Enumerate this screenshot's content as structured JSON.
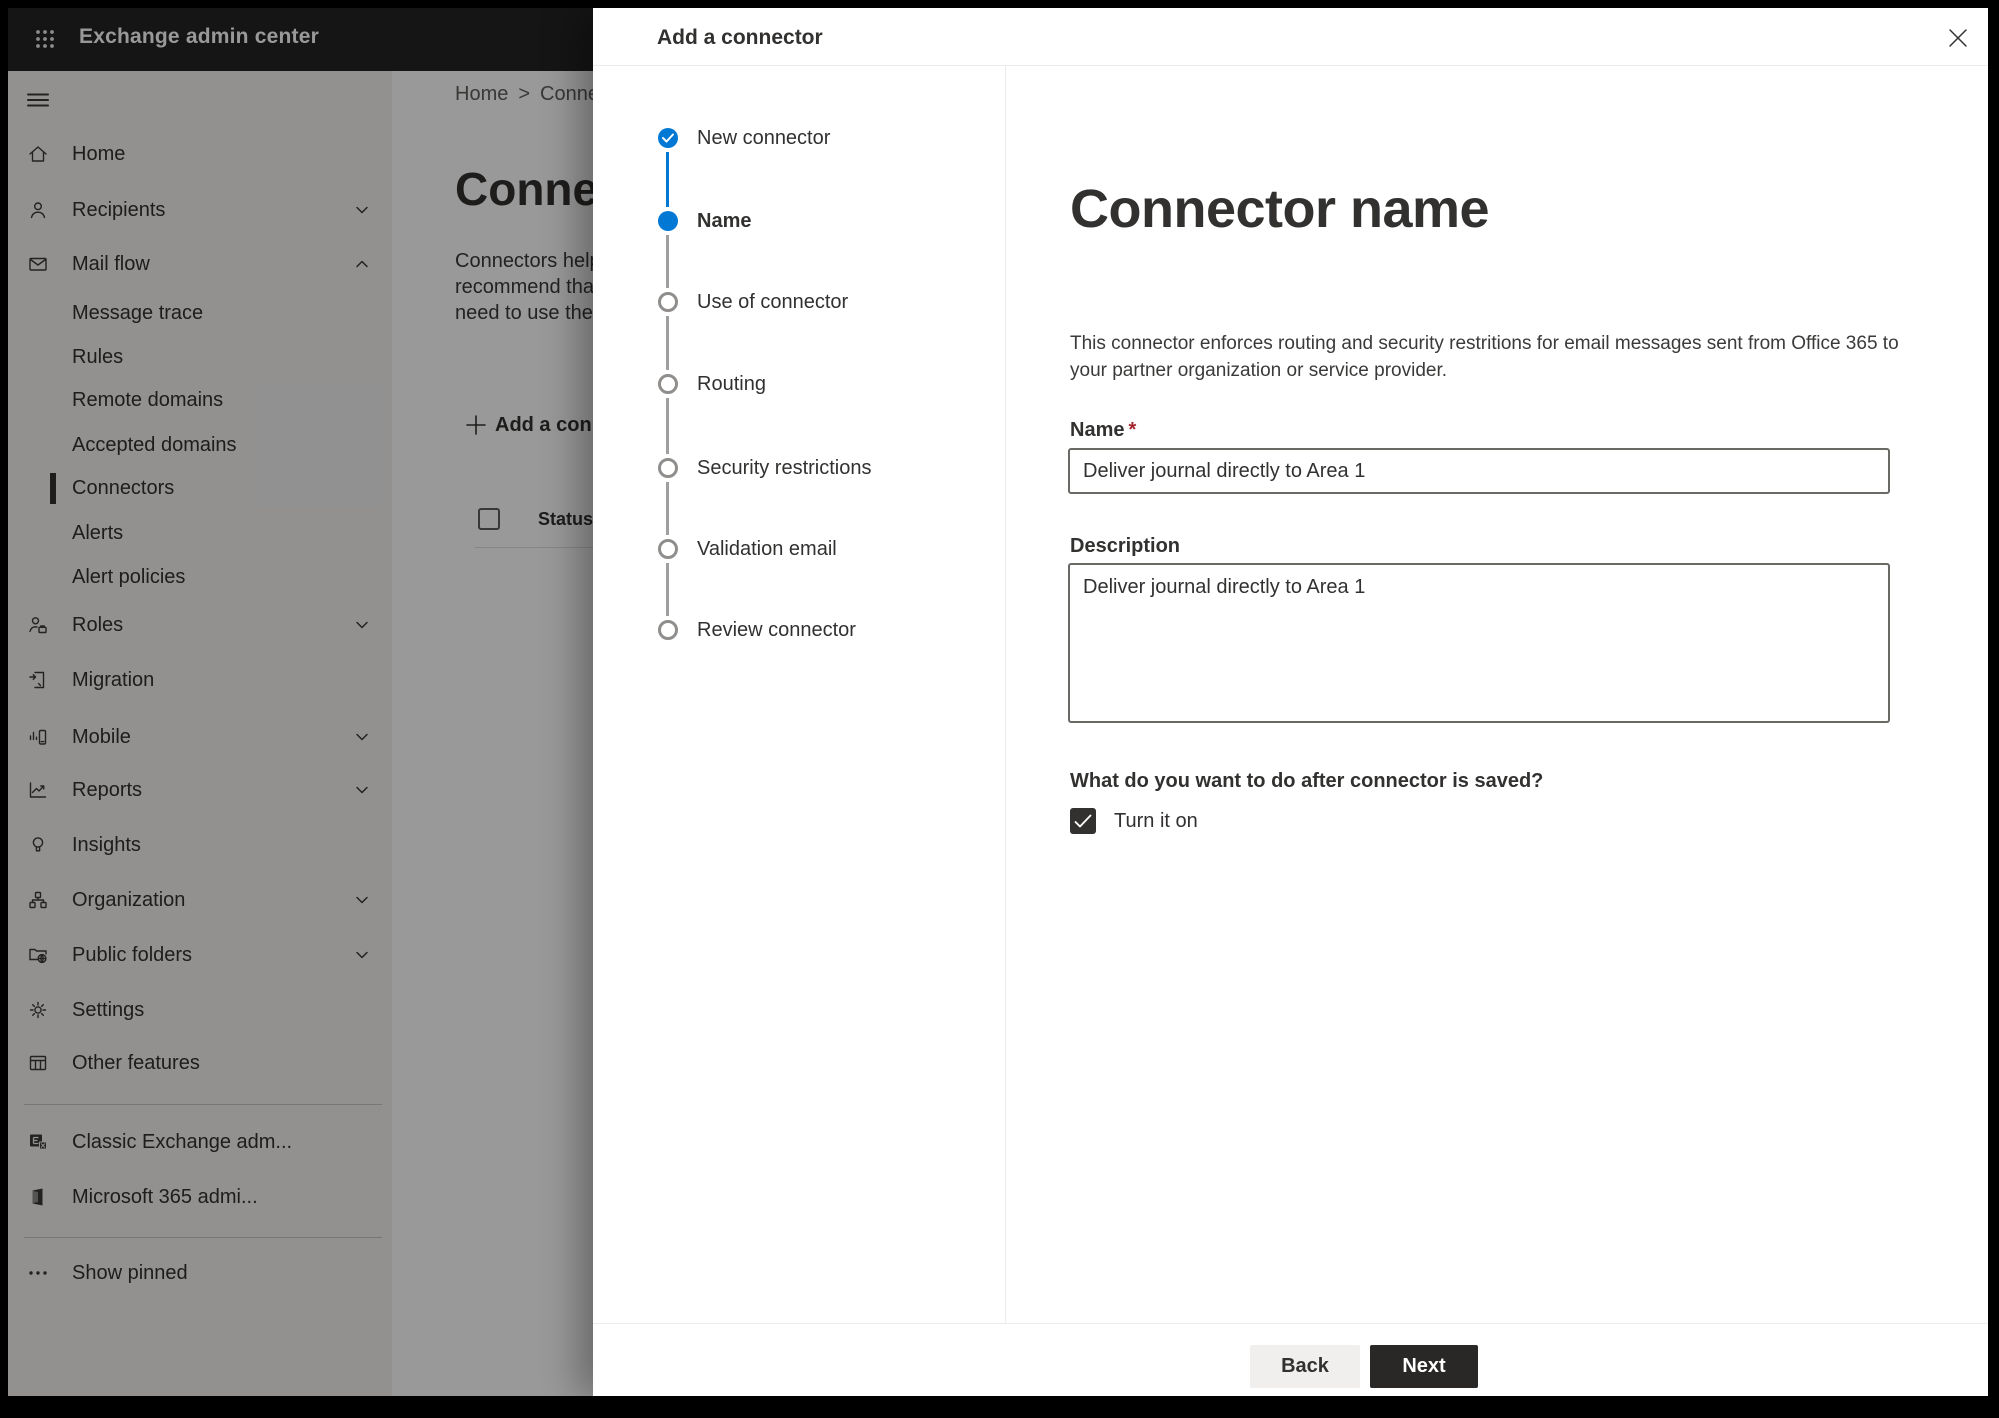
{
  "topbar": {
    "title": "Exchange admin center",
    "bg": "#232323"
  },
  "breadcrumb": {
    "home": "Home",
    "separator": ">",
    "current": "Conne"
  },
  "page": {
    "heading": "Connec",
    "intro_lines": {
      "0": "Connectors help",
      "1": "recommend that",
      "2": "need to use ther"
    },
    "add_button_label": "Add a conn",
    "status_header": "Status"
  },
  "sidebar": {
    "items": {
      "0": {
        "label": "Home"
      },
      "1": {
        "label": "Recipients"
      },
      "2": {
        "label": "Mail flow"
      },
      "3": {
        "label": "Message trace"
      },
      "4": {
        "label": "Rules"
      },
      "5": {
        "label": "Remote domains"
      },
      "6": {
        "label": "Accepted domains"
      },
      "7": {
        "label": "Connectors",
        "selected": true
      },
      "8": {
        "label": "Alerts"
      },
      "9": {
        "label": "Alert policies"
      },
      "10": {
        "label": "Roles"
      },
      "11": {
        "label": "Migration"
      },
      "12": {
        "label": "Mobile"
      },
      "13": {
        "label": "Reports"
      },
      "14": {
        "label": "Insights"
      },
      "15": {
        "label": "Organization"
      },
      "16": {
        "label": "Public folders"
      },
      "17": {
        "label": "Settings"
      },
      "18": {
        "label": "Other features"
      },
      "19": {
        "label": "Classic Exchange adm..."
      },
      "20": {
        "label": "Microsoft 365 admi..."
      },
      "21": {
        "label": "Show pinned"
      }
    }
  },
  "dialog": {
    "title": "Add a connector",
    "close_icon": "✕",
    "steps": {
      "0": {
        "label": "New connector",
        "state": "completed"
      },
      "1": {
        "label": "Name",
        "state": "current"
      },
      "2": {
        "label": "Use of connector",
        "state": "upcoming"
      },
      "3": {
        "label": "Routing",
        "state": "upcoming"
      },
      "4": {
        "label": "Security restrictions",
        "state": "upcoming"
      },
      "5": {
        "label": "Validation email",
        "state": "upcoming"
      },
      "6": {
        "label": "Review connector",
        "state": "upcoming"
      }
    },
    "content": {
      "heading": "Connector name",
      "description": "This connector enforces routing and security restritions for email messages sent from Office 365 to your partner organization or service provider.",
      "name_label": "Name",
      "required_mark": "*",
      "name_value": "Deliver journal directly to Area 1",
      "description_label": "Description",
      "description_value": "Deliver journal directly to Area 1",
      "after_save_question": "What do you want to do after connector is saved?",
      "turn_on_label": "Turn it on",
      "turn_on_checked": true
    },
    "footer": {
      "back_label": "Back",
      "next_label": "Next"
    }
  },
  "colors": {
    "accent": "#0078d4",
    "text": "#323130",
    "stepper_todo": "#908e8c",
    "required": "#a4262c"
  }
}
